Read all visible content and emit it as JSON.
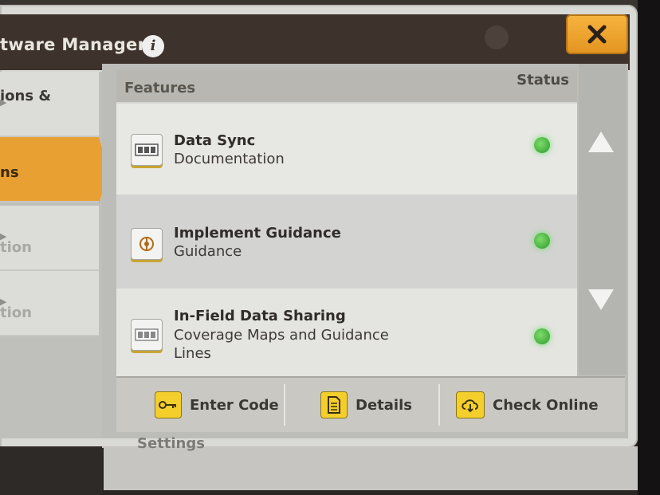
{
  "window": {
    "title": "tware Manager",
    "close_symbol": "✕"
  },
  "nav": {
    "items": [
      {
        "label": "ions &",
        "state": "normal"
      },
      {
        "label": "ns",
        "state": "active"
      },
      {
        "label": "tion",
        "state": "dimmed"
      },
      {
        "label": "tion",
        "state": "dimmed"
      }
    ],
    "below_label": "Settings"
  },
  "table": {
    "header_features": "Features",
    "header_status": "Status",
    "rows": [
      {
        "name": "Data Sync",
        "sub": "Documentation",
        "icon": "data-sync-icon",
        "status": "active"
      },
      {
        "name": "Implement Guidance",
        "sub": "Guidance",
        "icon": "implement-guidance-icon",
        "status": "active"
      },
      {
        "name": "In-Field Data Sharing",
        "sub": "Coverage Maps and Guidance Lines",
        "icon": "data-sharing-icon",
        "status": "active"
      }
    ]
  },
  "footer": {
    "enter_code": "Enter Code",
    "details": "Details",
    "check_online": "Check Online"
  },
  "colors": {
    "accent_orange": "#e8a033",
    "status_green": "#4bc84b",
    "icon_yellow": "#f4cf2b",
    "titlebar": "#3d332c"
  }
}
